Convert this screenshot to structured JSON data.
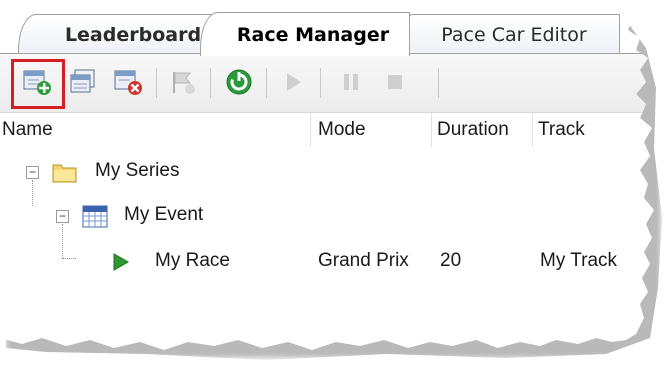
{
  "tabs": [
    {
      "label": "Leaderboard",
      "active": false
    },
    {
      "label": "Race Manager",
      "active": true
    },
    {
      "label": "Pace Car Editor",
      "active": false
    }
  ],
  "toolbar": {
    "buttons": [
      {
        "icon": "new-series-icon",
        "highlighted": true
      },
      {
        "icon": "new-event-icon"
      },
      {
        "icon": "delete-icon"
      },
      {
        "icon": "flag-icon",
        "disabled": true
      },
      {
        "icon": "refresh-icon"
      },
      {
        "icon": "play-icon",
        "disabled": true
      },
      {
        "icon": "pause-icon",
        "disabled": true
      },
      {
        "icon": "stop-icon",
        "disabled": true
      }
    ]
  },
  "columns": [
    "Name",
    "Mode",
    "Duration",
    "Track"
  ],
  "tree": {
    "series": {
      "name": "My Series",
      "expanded": true
    },
    "event": {
      "name": "My Event",
      "expanded": true
    },
    "race": {
      "name": "My Race",
      "mode": "Grand Prix",
      "duration": "20",
      "track": "My Track"
    }
  },
  "colors": {
    "highlight": "#d31f26",
    "play_green": "#2e9a2e",
    "folder_yellow": "#f3d36b"
  }
}
